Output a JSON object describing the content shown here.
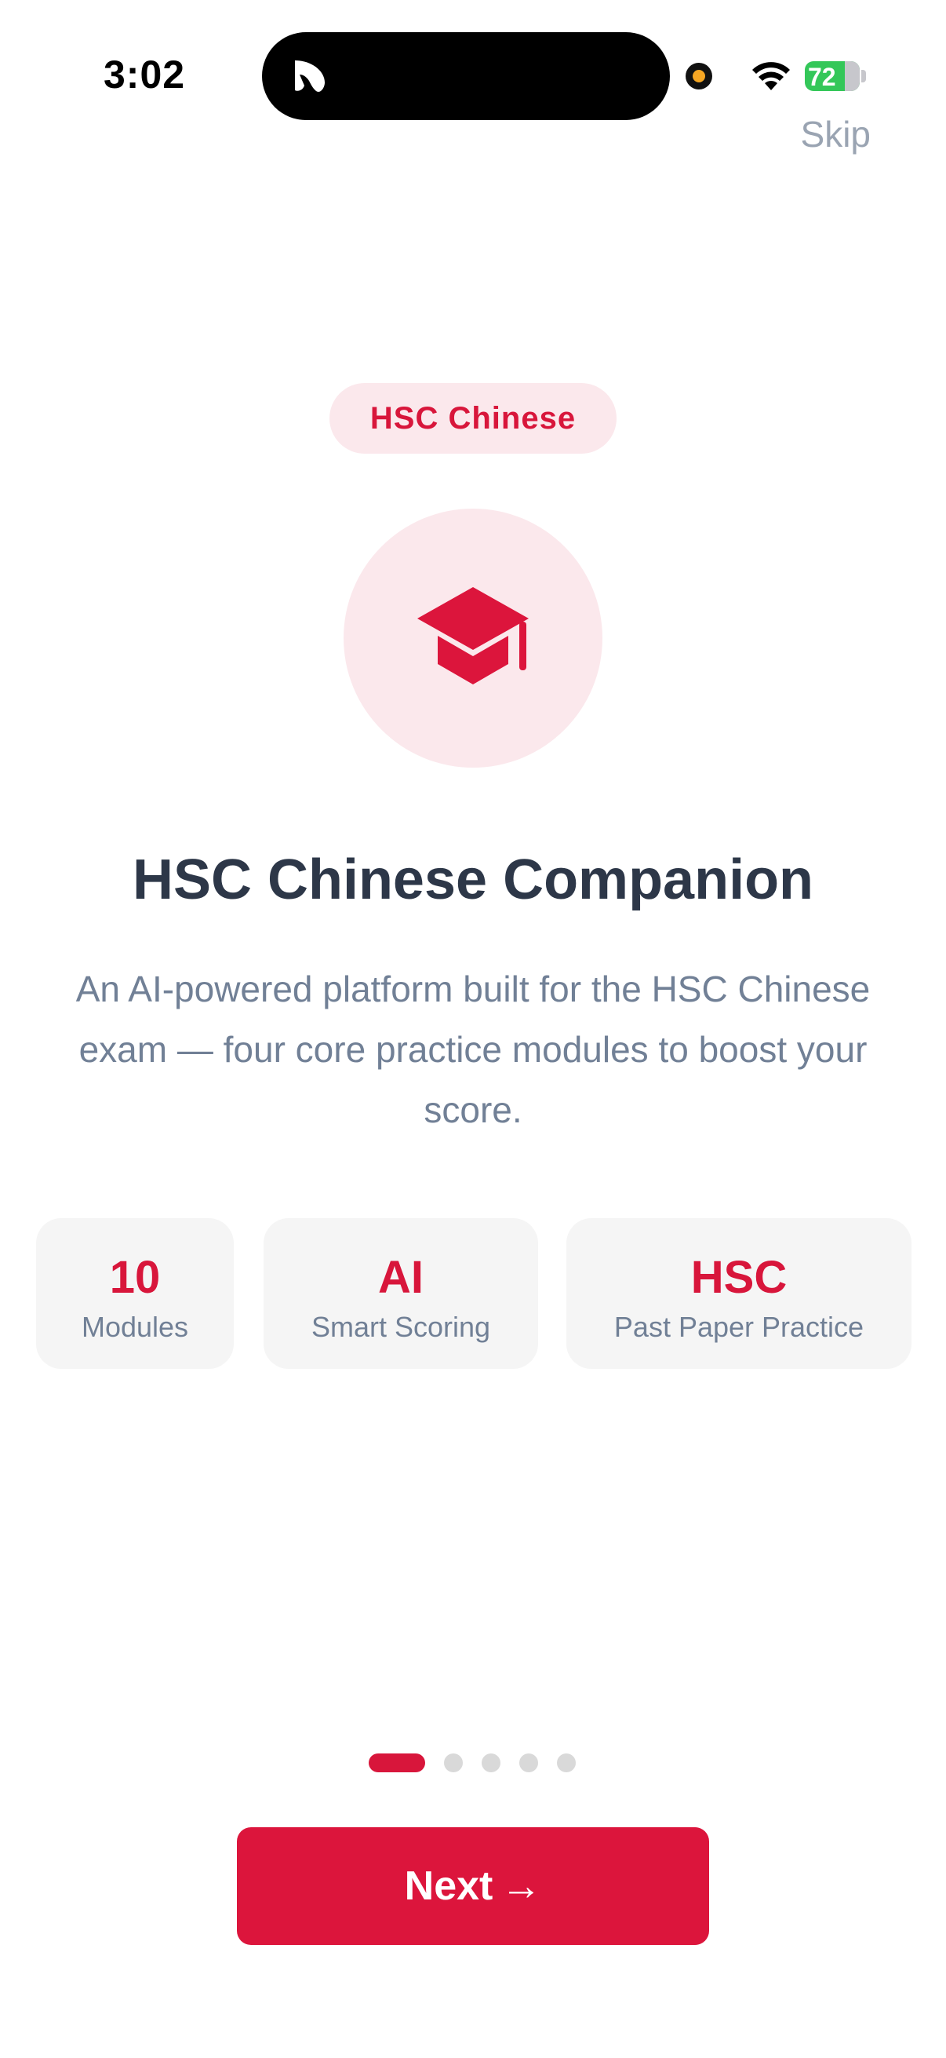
{
  "status_bar": {
    "time": "3:02",
    "battery": "72"
  },
  "header": {
    "skip_label": "Skip"
  },
  "hero": {
    "badge": "HSC Chinese",
    "icon": "graduation-cap-icon",
    "title": "HSC Chinese Companion",
    "description": "An AI-powered platform built for the HSC Chinese exam — four core practice modules to boost your score."
  },
  "stats": [
    {
      "value": "10",
      "label": "Modules"
    },
    {
      "value": "AI",
      "label": "Smart Scoring"
    },
    {
      "value": "HSC",
      "label": "Past Paper Practice"
    }
  ],
  "pagination": {
    "total_pages": 5,
    "current_page": 1
  },
  "footer": {
    "next_label": "Next",
    "next_icon": "arrow-right-icon"
  },
  "colors": {
    "accent": "#dc153c",
    "accent_soft": "#fbe8ec",
    "title": "#2d3748",
    "body_text": "#718096",
    "card_bg": "#f5f5f5"
  }
}
